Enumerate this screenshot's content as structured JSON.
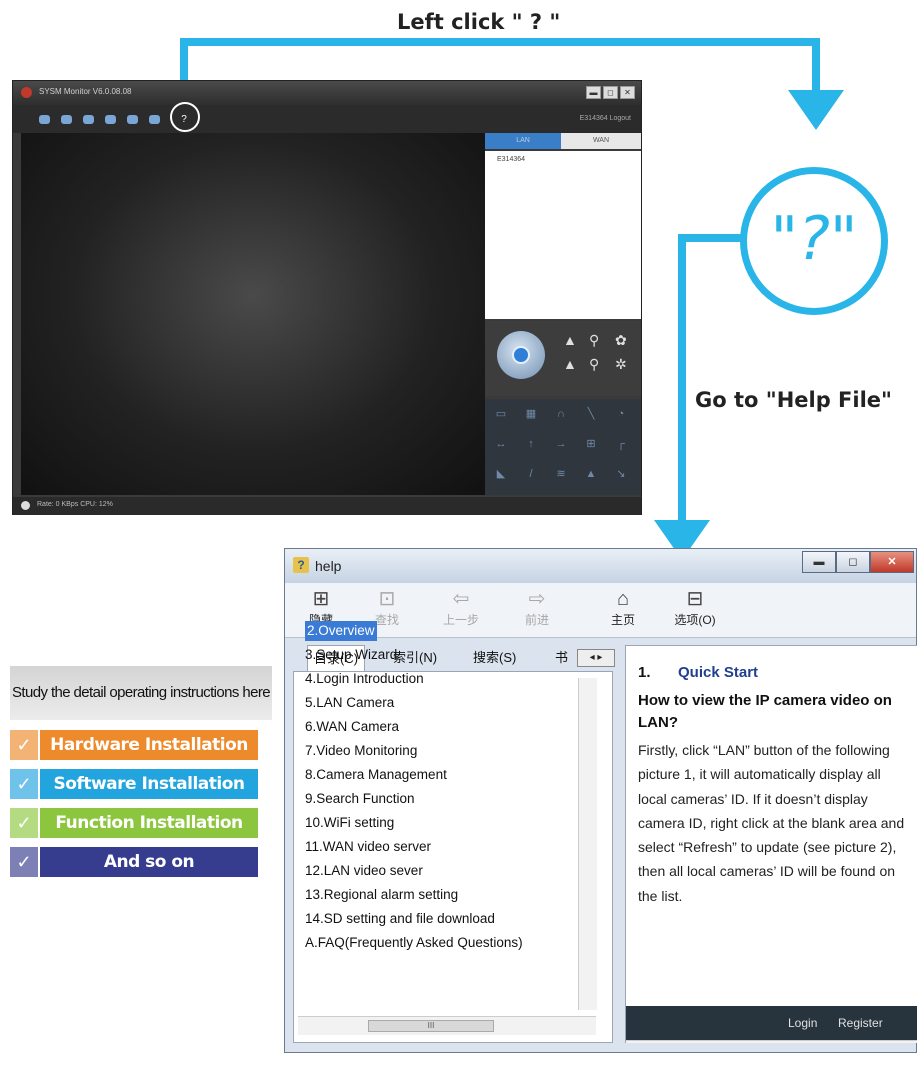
{
  "callouts": {
    "left_click": "Left click \" ? \"",
    "question": "\"?\"",
    "goto_help": "Go to \"Help File\""
  },
  "monitor": {
    "title": "SYSM Monitor  V6.0.08.08",
    "user": "E314364   Logout",
    "tabs": [
      "LAN",
      "WAN"
    ],
    "device_item": "E314364",
    "status": "Rate: 0 KBps   CPU: 12%",
    "winbtns": [
      "▬",
      "◻",
      "✕"
    ],
    "help_btn": "?"
  },
  "study_panel": {
    "header": "Study the detail operating instructions here",
    "items": [
      {
        "label": "Hardware Installation",
        "color": "#ec8a2c"
      },
      {
        "label": "Software Installation",
        "color": "#22a4df"
      },
      {
        "label": "Function Installation",
        "color": "#8cc63f"
      },
      {
        "label": "And so on",
        "color": "#363c8e"
      }
    ],
    "check": "✓"
  },
  "help_window": {
    "title": "help",
    "winbtns": [
      "▬",
      "◻",
      "✕"
    ],
    "toolbar": [
      {
        "label": "隐藏",
        "icon": "⊞",
        "icon_name": "hide-icon",
        "enabled": true
      },
      {
        "label": "查找",
        "icon": "⊡",
        "icon_name": "find-icon",
        "enabled": false
      },
      {
        "label": "上一步",
        "icon": "⇦",
        "icon_name": "back-icon",
        "enabled": false
      },
      {
        "label": "前进",
        "icon": "⇨",
        "icon_name": "forward-icon",
        "enabled": false
      },
      {
        "label": "主页",
        "icon": "⌂",
        "icon_name": "home-icon",
        "enabled": true
      },
      {
        "label": "选项(O)",
        "icon": "⊟",
        "icon_name": "options-icon",
        "enabled": true
      }
    ],
    "nav_tabs": [
      "目录(C)",
      "索引(N)",
      "搜索(S)",
      "书"
    ],
    "tab_scroll": "◂ ▸",
    "toc": [
      "2.Overview",
      "3.Setup Wizard",
      "4.Login Introduction",
      "5.LAN Camera",
      "6.WAN Camera",
      "7.Video Monitoring",
      "8.Camera Management",
      "9.Search Function",
      "10.WiFi setting",
      "11.WAN video server",
      "12.LAN video sever",
      "13.Regional alarm setting",
      "14.SD setting and file download",
      "A.FAQ(Frequently Asked Questions)"
    ],
    "content": {
      "number": "1.",
      "title": "Quick Start",
      "subtitle": "How to view the IP camera video on LAN?",
      "body": "Firstly, click “LAN” button of the following picture 1, it will automatically display all local cameras’ ID. If it doesn’t display camera ID, right click at the blank area and select “Refresh” to update (see picture 2), then all local cameras’ ID will be found on the list.",
      "footer_login": "Login",
      "footer_register": "Register"
    },
    "scroll_thumb": "III"
  }
}
